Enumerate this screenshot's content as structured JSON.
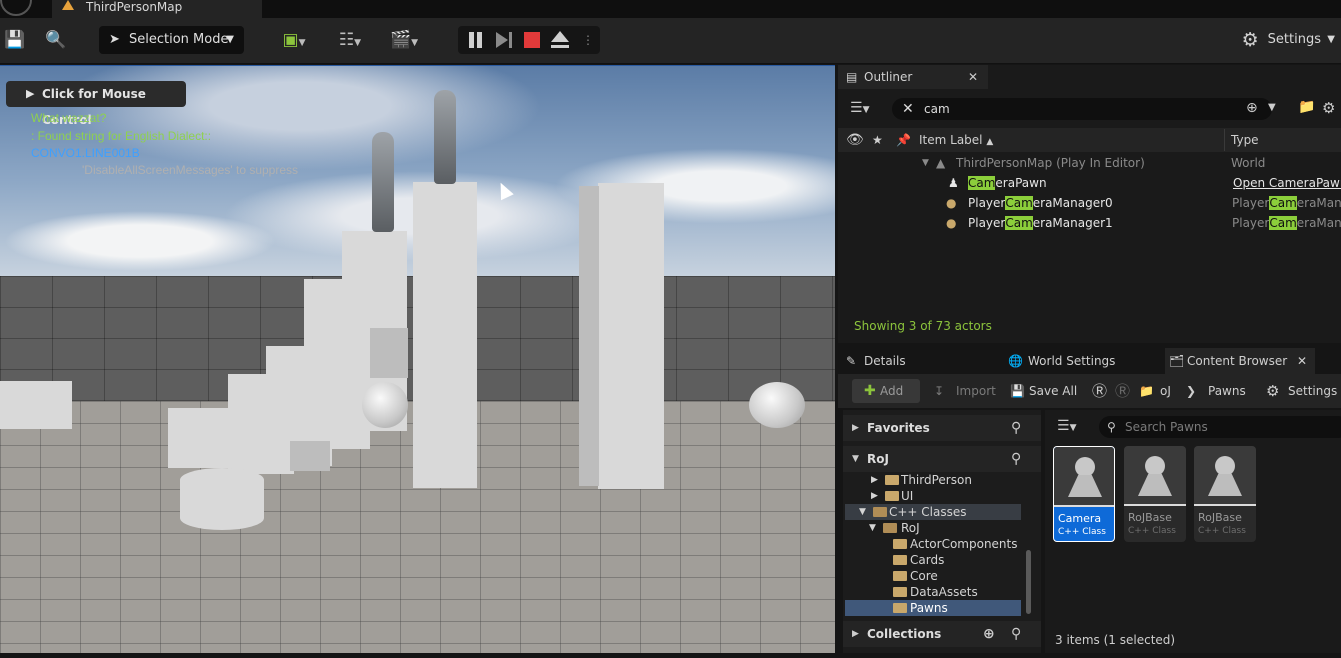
{
  "titlebar": {
    "tab_title": "ThirdPersonMap"
  },
  "toolbar": {
    "selection_mode": "Selection Mode",
    "settings": "Settings"
  },
  "viewport": {
    "mouse_control": "Click for Mouse Control",
    "debug_lines": [
      {
        "text": "What wazzat?",
        "color": "#8fd14f"
      },
      {
        "text": ": Found string for English Dialect::",
        "color": "#8fd14f"
      },
      {
        "text": "CONVO1.LINE001B",
        "color": "#3ea0ff"
      },
      {
        "text": "'DisableAllScreenMessages' to suppress",
        "color": "#b0b0b0"
      }
    ]
  },
  "outliner": {
    "tab_label": "Outliner",
    "search_value": "cam",
    "col_item_label": "Item Label",
    "col_type": "Type",
    "rows": [
      {
        "pre": "",
        "hl": "",
        "post": "ThirdPersonMap (Play In Editor)",
        "type": "World"
      },
      {
        "pre": "",
        "hl": "Cam",
        "post": "eraPawn",
        "type": "Open CameraPawn"
      },
      {
        "pre": "Player",
        "hl": "Cam",
        "post": "eraManager0",
        "type_pre": "Player",
        "type_hl": "Cam",
        "type_post": "eraMana"
      },
      {
        "pre": "Player",
        "hl": "Cam",
        "post": "eraManager1",
        "type_pre": "Player",
        "type_hl": "Cam",
        "type_post": "eraMana"
      }
    ],
    "showing": "Showing 3 of 73 actors"
  },
  "lower_tabs": {
    "details": "Details",
    "world_settings": "World Settings",
    "content_browser": "Content Browser"
  },
  "content_browser": {
    "add": "Add",
    "import": "Import",
    "save_all": "Save All",
    "path": [
      "oJ",
      "Pawns"
    ],
    "settings": "Settings",
    "search_placeholder": "Search Pawns",
    "favorites": "Favorites",
    "root": "RoJ",
    "tree": [
      {
        "label": "ThirdPerson",
        "indent": 1
      },
      {
        "label": "UI",
        "indent": 1
      },
      {
        "label": "C++ Classes",
        "indent": 1
      },
      {
        "label": "RoJ",
        "indent": 2
      },
      {
        "label": "ActorComponents",
        "indent": 3
      },
      {
        "label": "Cards",
        "indent": 3
      },
      {
        "label": "Core",
        "indent": 3
      },
      {
        "label": "DataAssets",
        "indent": 3
      },
      {
        "label": "Pawns",
        "indent": 3
      }
    ],
    "collections": "Collections",
    "assets": [
      {
        "name": "Camera",
        "class": "C++ Class",
        "selected": true
      },
      {
        "name": "RoJBase",
        "class": "C++ Class",
        "selected": false
      },
      {
        "name": "RoJBase",
        "class": "C++ Class",
        "selected": false
      }
    ],
    "items_count": "3 items (1 selected)"
  }
}
